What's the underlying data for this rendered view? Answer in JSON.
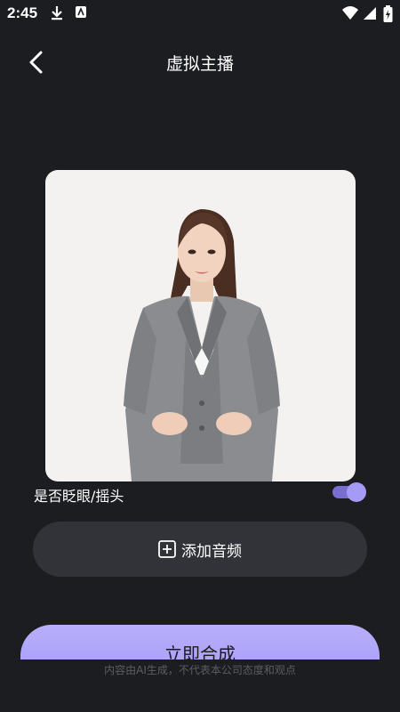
{
  "status_bar": {
    "time": "2:45"
  },
  "header": {
    "title": "虚拟主播"
  },
  "toggle_row": {
    "label": "是否眨眼/摇头",
    "enabled": true
  },
  "add_audio": {
    "label": "添加音频"
  },
  "compose": {
    "label": "立即合成"
  },
  "disclaimer": "内容由AI生成，不代表本公司态度和观点",
  "colors": {
    "background": "#1c1d21",
    "accent": "#a69cf5",
    "button_bg": "#323338"
  }
}
